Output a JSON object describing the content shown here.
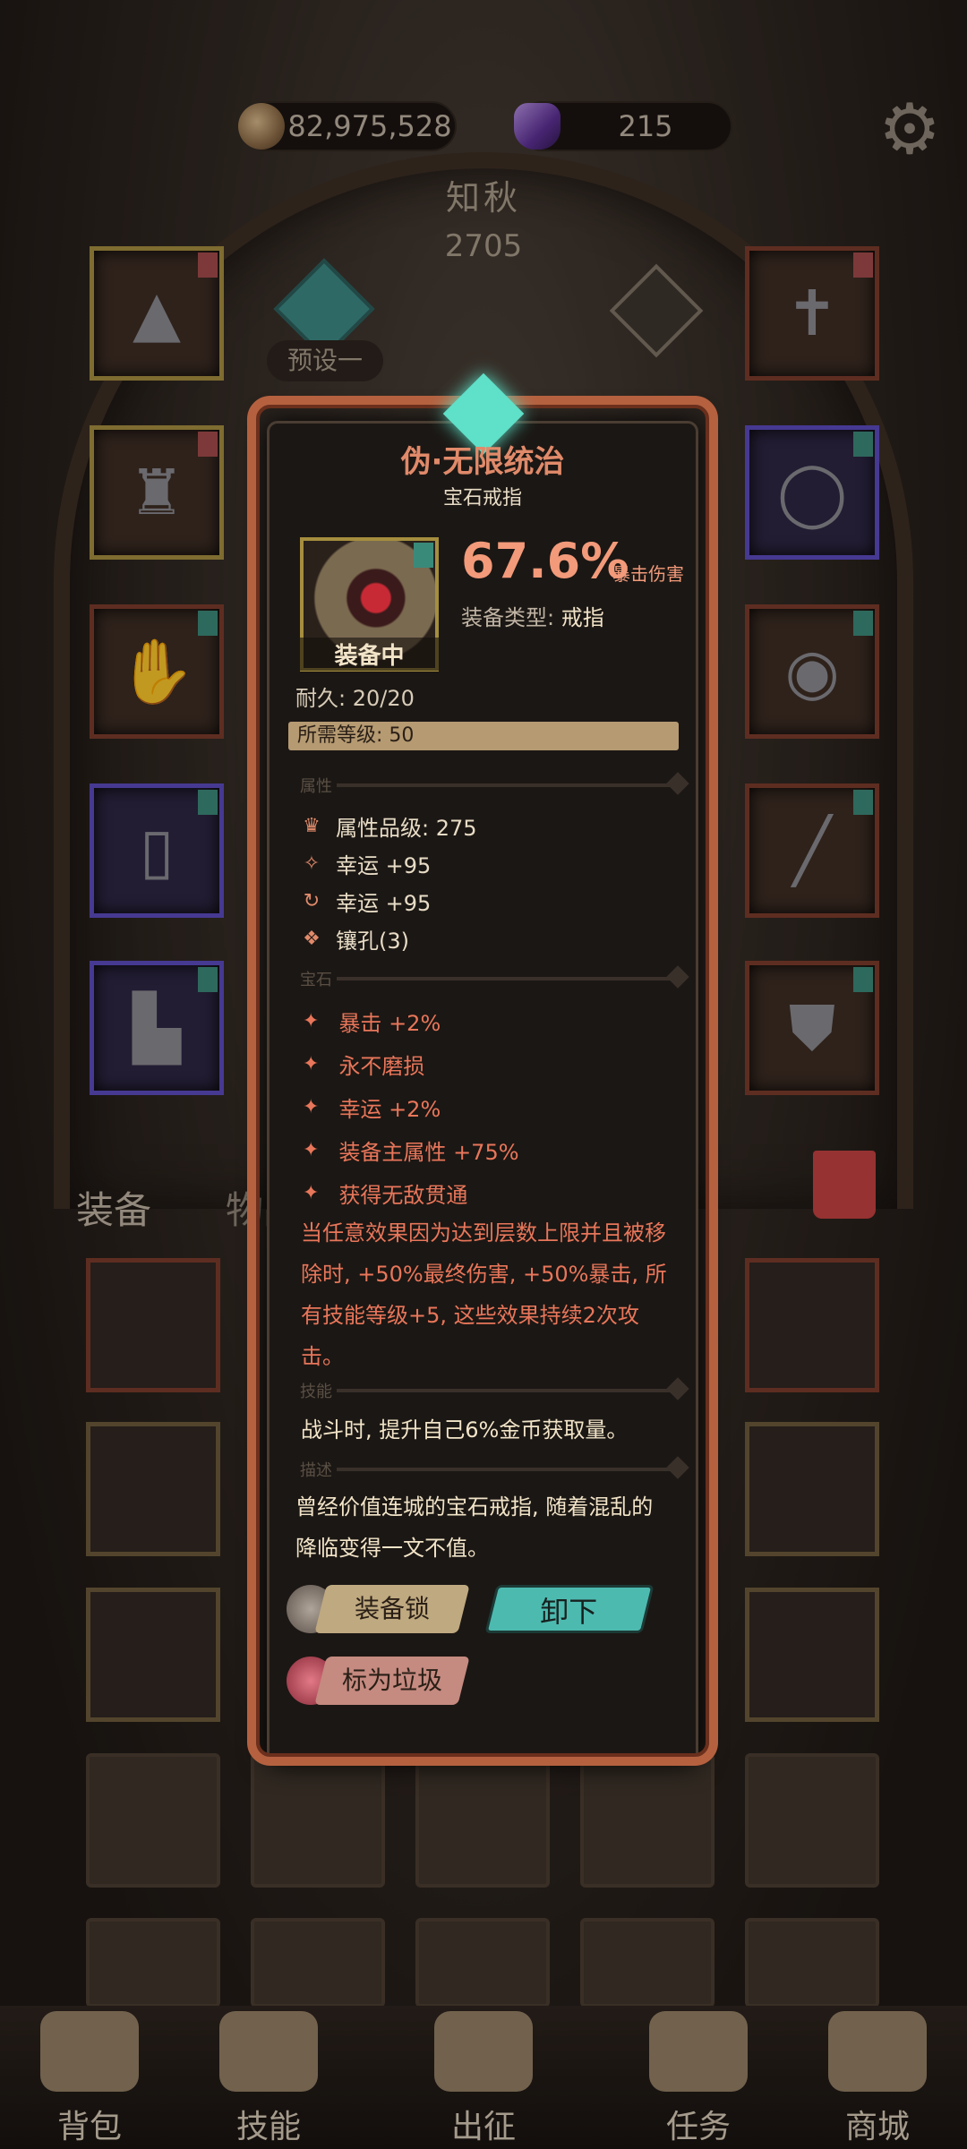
{
  "currency": {
    "gold": "82,975,528",
    "gems": "215"
  },
  "icons": {
    "gold": "gold-coin-icon",
    "gem": "purple-gem-icon",
    "settings": "gear-icon"
  },
  "hero": {
    "name": "知秋",
    "power": "2705"
  },
  "preset": {
    "label": "预设一"
  },
  "inventory_tabs": {
    "equipment": "装备",
    "items": "物品"
  },
  "tooltip": {
    "name": "伪·无限统治",
    "subtitle": "宝石戒指",
    "main_stat_value": "67.6%",
    "main_stat_label": "暴击伤害",
    "equipped_label": "装备中",
    "type_label": "装备类型:",
    "type_value": "戒指",
    "durability": "耐久: 20/20",
    "required_level": "所需等级: 50",
    "sections": {
      "attributes": "属性",
      "gems": "宝石",
      "skills": "技能",
      "description": "描述"
    },
    "attributes": [
      {
        "icon": "crown-icon",
        "text": "属性品级: 275"
      },
      {
        "icon": "clover-icon",
        "text": "幸运 +95"
      },
      {
        "icon": "cycle-icon",
        "text": "幸运 +95"
      },
      {
        "icon": "socket-icon",
        "text": "镶孔(3)"
      }
    ],
    "gems": [
      "暴击 +2%",
      "永不磨损",
      "幸运 +2%",
      "装备主属性 +75%",
      "获得无敌贯通"
    ],
    "gem_effect": "当任意效果因为达到层数上限并且被移除时, +50%最终伤害, +50%暴击, 所有技能等级+5, 这些效果持续2次攻击。",
    "skill": "战斗时, 提升自己6%金币获取量。",
    "description": "曾经价值连城的宝石戒指, 随着混乱的降临变得一文不值。",
    "buttons": {
      "lock": "装备锁",
      "unequip": "卸下",
      "mark_trash": "标为垃圾"
    }
  },
  "bottom_nav": [
    {
      "label": "背包",
      "icon": "backpack-icon"
    },
    {
      "label": "技能",
      "icon": "skill-book-icon"
    },
    {
      "label": "出征",
      "icon": "sword-icon"
    },
    {
      "label": "任务",
      "icon": "quest-scroll-icon"
    },
    {
      "label": "商城",
      "icon": "shop-icon"
    }
  ],
  "colors": {
    "accent_teal": "#4dbab0",
    "rarity_gold": "#a58e3e",
    "rarity_purple": "#5a4ac0",
    "stat_red": "#e8765a"
  }
}
